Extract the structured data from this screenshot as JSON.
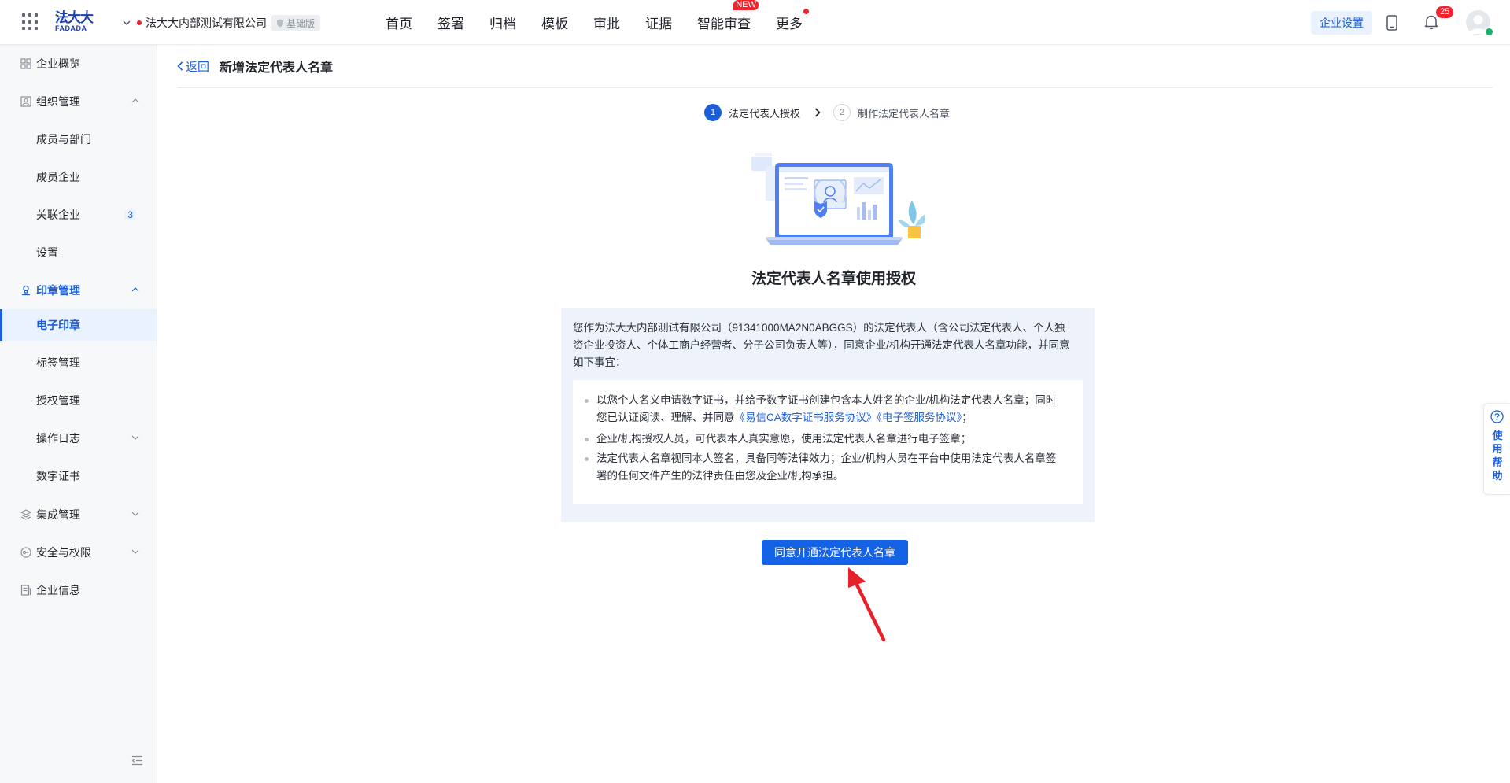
{
  "topbar": {
    "logo_cn": "法大大",
    "logo_en": "FADADA",
    "company_name": "法大大内部测试有限公司",
    "edition_badge": "基础版",
    "nav": [
      {
        "label": "首页"
      },
      {
        "label": "签署"
      },
      {
        "label": "归档"
      },
      {
        "label": "模板"
      },
      {
        "label": "审批"
      },
      {
        "label": "证据"
      },
      {
        "label": "智能审查",
        "tag": "NEW"
      },
      {
        "label": "更多",
        "dot": true
      }
    ],
    "enterprise_settings": "企业设置",
    "notification_count": "25"
  },
  "sidebar": {
    "items": [
      {
        "label": "企业概览",
        "icon": "overview-icon"
      },
      {
        "label": "组织管理",
        "icon": "org-icon",
        "expanded": true
      },
      {
        "label": "成员与部门"
      },
      {
        "label": "成员企业"
      },
      {
        "label": "关联企业",
        "count": "3"
      },
      {
        "label": "设置"
      },
      {
        "label": "印章管理",
        "icon": "seal-icon",
        "expanded": true
      },
      {
        "label": "电子印章",
        "active": true
      },
      {
        "label": "标签管理"
      },
      {
        "label": "授权管理"
      },
      {
        "label": "操作日志",
        "expandable": true
      },
      {
        "label": "数字证书"
      },
      {
        "label": "集成管理",
        "icon": "layers-icon"
      },
      {
        "label": "安全与权限",
        "icon": "security-icon"
      },
      {
        "label": "企业信息",
        "icon": "info-icon"
      }
    ]
  },
  "main": {
    "back": "返回",
    "title": "新增法定代表人名章",
    "steps": [
      {
        "num": "1",
        "label": "法定代表人授权",
        "active": true
      },
      {
        "num": "2",
        "label": "制作法定代表人名章",
        "active": false
      }
    ],
    "auth_title": "法定代表人名章使用授权",
    "intro_lines": [
      "您作为法大大内部测试有限公司（91341000MA2N0ABGGS）的法定代表人（含公司法定代表人、个人独",
      "资企业投资人、个体工商户经营者、分子公司负责人等），同意企业/机构开通法定代表人名章功能，并同意",
      "如下事宜："
    ],
    "terms": {
      "t1_line1": "以您个人名义申请数字证书，并给予数字证书创建包含本人姓名的企业/机构法定代表人名章；同时",
      "t1_line2_prefix": "您已认证阅读、理解、并同意",
      "t1_link1": "《易信CA数字证书服务协议》",
      "t1_link2": "《电子签服务协议》",
      "t1_line2_suffix": "；",
      "t2": "企业/机构授权人员，可代表本人真实意愿，使用法定代表人名章进行电子签章；",
      "t3_line1": "法定代表人名章视同本人签名，具备同等法律效力；企业/机构人员在平台中使用法定代表人名章签",
      "t3_line2": "署的任何文件产生的法律责任由您及企业/机构承担。"
    },
    "agree_button": "同意开通法定代表人名章",
    "help": [
      "使",
      "用",
      "帮",
      "助"
    ]
  },
  "colors": {
    "primary": "#1b5ed8",
    "button": "#1463e6",
    "badge_red": "#f5222d",
    "info_bg": "#eef3fb",
    "arrow_red": "#e8202a"
  }
}
